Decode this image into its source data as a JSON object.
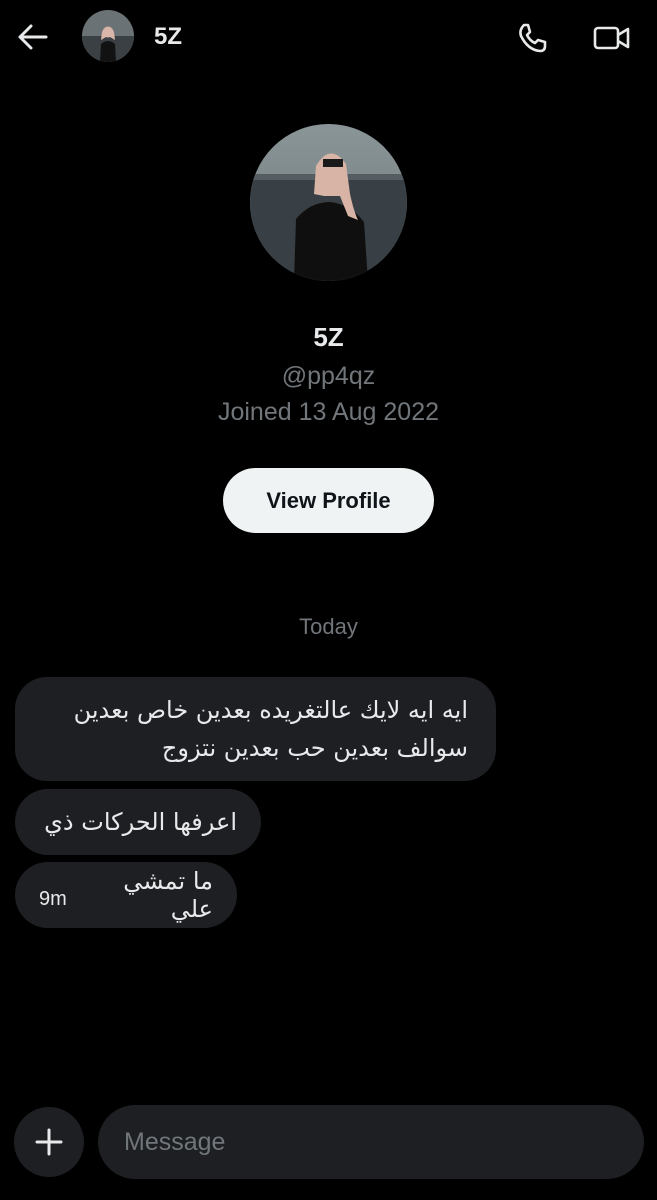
{
  "header": {
    "name": "5Z"
  },
  "profile": {
    "name": "5Z",
    "handle": "@pp4qz",
    "joined": "Joined 13 Aug 2022",
    "view_profile_label": "View Profile"
  },
  "conversation": {
    "day_label": "Today",
    "messages": [
      {
        "line1": "ايه ايه لايك عالتغريده بعدين خاص بعدين",
        "line2": "سوالف بعدين حب بعدين نتزوج"
      },
      {
        "text": "اعرفها الحركات ذي"
      },
      {
        "text": "ما تمشي علي",
        "time": "9m"
      }
    ]
  },
  "composer": {
    "placeholder": "Message"
  },
  "icons": {
    "back": "arrow-left-icon",
    "call": "phone-icon",
    "video": "video-camera-icon",
    "add": "plus-icon"
  },
  "colors": {
    "background": "#000000",
    "bubble": "#1d1f22",
    "text_primary": "#e7e9ea",
    "text_secondary": "#71767b",
    "button_bg": "#eff3f4"
  }
}
